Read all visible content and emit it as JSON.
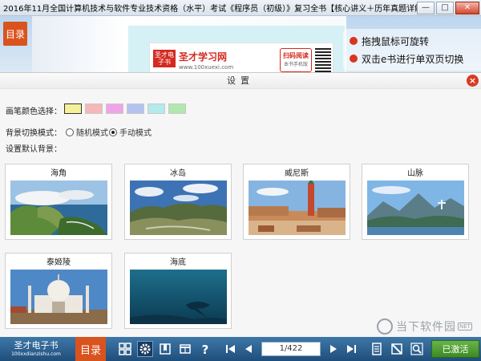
{
  "window": {
    "title": "2016年11月全国计算机技术与软件专业技术资格（水平）考试《程序员（初级）》复习全书【核心讲义＋历年真题详解】",
    "minimize_glyph": "—",
    "maximize_glyph": "□",
    "close_glyph": "✕"
  },
  "banner": {
    "toc_label": "目录",
    "ad": {
      "logo_text": "圣才电子书",
      "site_name": "圣才学习网",
      "url": "www.100xuexi.com",
      "scan_title": "扫码阅读",
      "scan_sub": "本书手机版"
    },
    "tips": [
      "拖拽鼠标可旋转",
      "双击e书进行单双页切换"
    ]
  },
  "settings": {
    "title": "设置",
    "pen_color_label": "画笔颜色选择：",
    "pen_colors": [
      "#f5f19a",
      "#f4b8b8",
      "#f0a4e8",
      "#b4c2f0",
      "#b4eaec",
      "#b0e8b0"
    ],
    "bg_mode_label": "背景切换模式：",
    "bg_modes": [
      {
        "label": "随机模式",
        "selected": false
      },
      {
        "label": "手动模式",
        "selected": true
      }
    ],
    "default_bg_label": "设置默认背景：",
    "backgrounds": [
      "海角",
      "冰岛",
      "威尼斯",
      "山脉",
      "泰姬陵",
      "海底"
    ]
  },
  "toolbar": {
    "brand_name": "圣才电子书",
    "brand_url": "100xxdianzishu.com",
    "toc_label": "目录",
    "page_indicator": "1/422",
    "activate_label": "已激活"
  },
  "watermark": {
    "text": "当下软件园",
    "tag": "NET"
  }
}
